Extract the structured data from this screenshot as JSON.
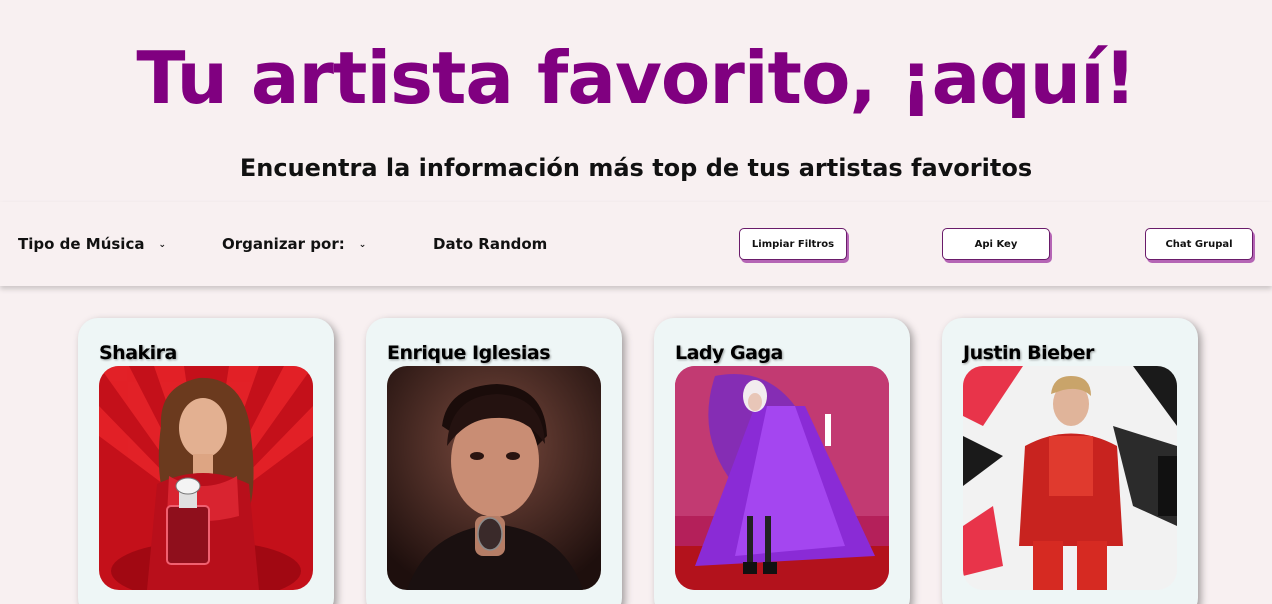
{
  "header": {
    "title": "Tu artista favorito, ¡aquí!",
    "subtitle": "Encuentra la información más top de tus artistas favoritos"
  },
  "filters": {
    "music_type": "Tipo de Música",
    "organize_by": "Organizar por:",
    "random_fact": "Dato Random"
  },
  "buttons": {
    "clear_filters": "Limpiar Filtros",
    "api_key": "Api Key",
    "group_chat": "Chat Grupal"
  },
  "artists": [
    {
      "name": "Shakira"
    },
    {
      "name": "Enrique Iglesias"
    },
    {
      "name": "Lady Gaga"
    },
    {
      "name": "Justin Bieber"
    }
  ],
  "colors": {
    "title": "#800080",
    "button_border": "#6a1b6a",
    "button_shadow": "#b565b5",
    "card_bg": "#eef6f6"
  }
}
